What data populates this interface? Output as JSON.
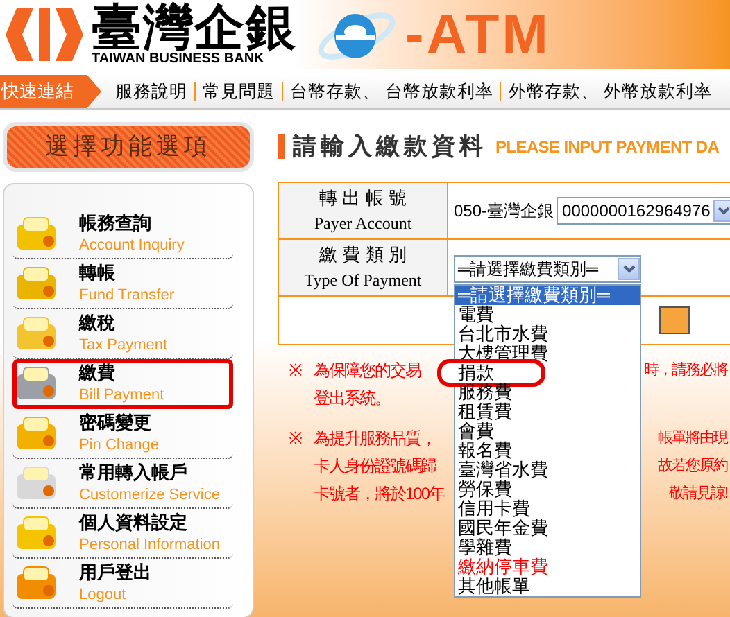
{
  "brand": {
    "name_zh": "臺灣企銀",
    "name_en": "TAIWAN BUSINESS BANK",
    "product": "-ATM"
  },
  "nav": {
    "label": "快速連結",
    "links": [
      "服務說明",
      "常見問題",
      "台幣存款、 台幣放款利率",
      "外幣存款、 外幣放款利率"
    ]
  },
  "sidebar": {
    "title": "選擇功能選項",
    "items": [
      {
        "zh": "帳務查詢",
        "en": "Account Inquiry",
        "highlighted": false
      },
      {
        "zh": "轉帳",
        "en": "Fund Transfer",
        "highlighted": false
      },
      {
        "zh": "繳稅",
        "en": "Tax Payment",
        "highlighted": false
      },
      {
        "zh": "繳費",
        "en": "Bill Payment",
        "highlighted": true
      },
      {
        "zh": "密碼變更",
        "en": "Pin Change",
        "highlighted": false
      },
      {
        "zh": "常用轉入帳戶",
        "en": "Customerize Service",
        "highlighted": false
      },
      {
        "zh": "個人資料設定",
        "en": "Personal Information",
        "highlighted": false
      },
      {
        "zh": "用戶登出",
        "en": "Logout",
        "highlighted": false
      }
    ]
  },
  "page_title": {
    "zh": "請輸入繳款資料",
    "en": "PLEASE INPUT PAYMENT DA"
  },
  "form": {
    "payer_account": {
      "label_zh": "轉 出 帳 號",
      "label_en": "Payer Account",
      "bank": "050-臺灣企銀",
      "value": "0000000162964976"
    },
    "payment_type": {
      "label_zh": "繳 費 類 別",
      "label_en": "Type Of Payment",
      "value": "═請選擇繳費類別═",
      "options": [
        {
          "label": "═請選擇繳費類別═",
          "selected": true,
          "highlighted": false,
          "red": false
        },
        {
          "label": "電費",
          "selected": false,
          "highlighted": false,
          "red": false
        },
        {
          "label": "台北市水費",
          "selected": false,
          "highlighted": false,
          "red": false
        },
        {
          "label": "大樓管理費",
          "selected": false,
          "highlighted": false,
          "red": false
        },
        {
          "label": "捐款",
          "selected": false,
          "highlighted": true,
          "red": false
        },
        {
          "label": "服務費",
          "selected": false,
          "highlighted": false,
          "red": false
        },
        {
          "label": "租賃費",
          "selected": false,
          "highlighted": false,
          "red": false
        },
        {
          "label": "會費",
          "selected": false,
          "highlighted": false,
          "red": false
        },
        {
          "label": "報名費",
          "selected": false,
          "highlighted": false,
          "red": false
        },
        {
          "label": "臺灣省水費",
          "selected": false,
          "highlighted": false,
          "red": false
        },
        {
          "label": "勞保費",
          "selected": false,
          "highlighted": false,
          "red": false
        },
        {
          "label": "信用卡費",
          "selected": false,
          "highlighted": false,
          "red": false
        },
        {
          "label": "國民年金費",
          "selected": false,
          "highlighted": false,
          "red": false
        },
        {
          "label": "學雜費",
          "selected": false,
          "highlighted": false,
          "red": false
        },
        {
          "label": "繳納停車費",
          "selected": false,
          "highlighted": false,
          "red": true
        },
        {
          "label": "其他帳單",
          "selected": false,
          "highlighted": false,
          "red": false
        }
      ]
    }
  },
  "notices": [
    {
      "mark": "※",
      "lines": [
        {
          "left": "為保障您的交易",
          "right": "時，請務必將"
        },
        {
          "left": "登出系統。"
        }
      ]
    },
    {
      "mark": "※",
      "lines": [
        {
          "left": "為提升服務品質，",
          "right": "帳單將由現"
        },
        {
          "left": "卡人身份證號碼歸",
          "right": "故若您原約"
        },
        {
          "left": "卡號者，將於100年",
          "right": "敬請見諒!"
        }
      ]
    }
  ]
}
